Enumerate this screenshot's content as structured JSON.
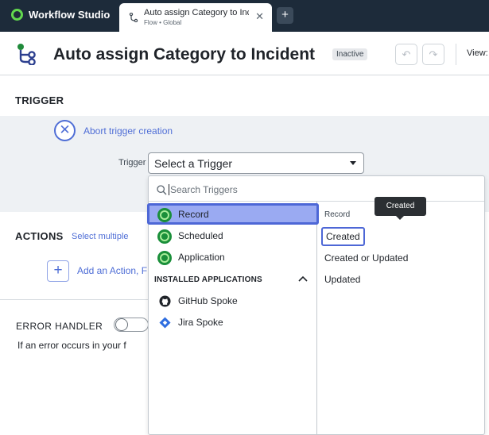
{
  "app": {
    "name": "Workflow Studio"
  },
  "tab": {
    "title": "Auto assign Category to Incident",
    "subtitle": "Flow • Global",
    "close_glyph": "✕",
    "new_tab_glyph": "+"
  },
  "flow": {
    "title": "Auto assign Category to Incident",
    "status": "Inactive",
    "undo_glyph": "↶",
    "redo_glyph": "↷",
    "view_label": "View:"
  },
  "trigger": {
    "section_title": "TRIGGER",
    "abort_label": "Abort trigger creation",
    "abort_glyph": "✕",
    "field_label": "Trigger",
    "select_value": "Select a Trigger"
  },
  "dropdown": {
    "search_placeholder": "Search Triggers",
    "trigger_types": [
      {
        "label": "Record",
        "selected": true
      },
      {
        "label": "Scheduled",
        "selected": false
      },
      {
        "label": "Application",
        "selected": false
      }
    ],
    "installed_header": "INSTALLED APPLICATIONS",
    "installed_apps": [
      {
        "label": "GitHub Spoke",
        "icon": "github-icon"
      },
      {
        "label": "Jira Spoke",
        "icon": "jira-icon"
      }
    ],
    "options_header": "Record",
    "options": [
      {
        "label": "Created",
        "highlighted": true
      },
      {
        "label": "Created or Updated",
        "highlighted": false
      },
      {
        "label": "Updated",
        "highlighted": false
      }
    ],
    "tooltip": "Created"
  },
  "actions": {
    "section_title": "ACTIONS",
    "select_multiple": "Select multiple",
    "add_label": "Add an Action, F",
    "add_glyph": "+"
  },
  "error_handler": {
    "title": "ERROR HANDLER",
    "description": "If an error occurs in your f",
    "enabled": false
  },
  "colors": {
    "topbar": "#1d2b3a",
    "accent": "#4f6ed6",
    "selected_bg": "#9aaaf2",
    "trigger_icon": "#1a8f3a"
  }
}
